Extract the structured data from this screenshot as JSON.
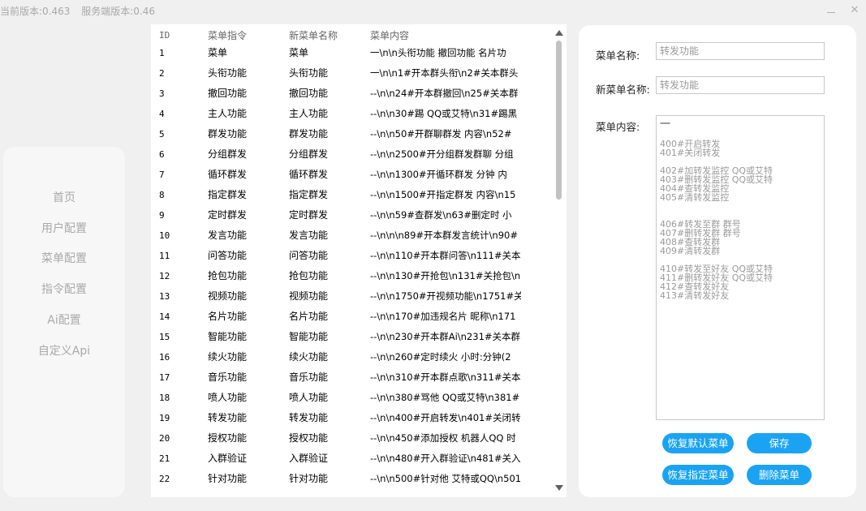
{
  "title_bar": {
    "client_version": "当前版本:0.463",
    "server_version": "服务端版本:0.46",
    "minimize_glyph": "",
    "close_glyph": "✕"
  },
  "sidebar": {
    "items": [
      {
        "label": "首页"
      },
      {
        "label": "用户配置"
      },
      {
        "label": "菜单配置"
      },
      {
        "label": "指令配置"
      },
      {
        "label": "Ai配置"
      },
      {
        "label": "自定义Api"
      }
    ]
  },
  "menu_list": {
    "columns": [
      "ID",
      "菜单指令",
      "新菜单名称",
      "菜单内容"
    ],
    "rows": [
      {
        "id": "1",
        "command": "菜单",
        "name": "菜单",
        "content": "一\\n\\n头衔功能 撤回功能 名片功"
      },
      {
        "id": "2",
        "command": "头衔功能",
        "name": "头衔功能",
        "content": "一\\n\\n1#开本群头衔\\n2#关本群头"
      },
      {
        "id": "3",
        "command": "撤回功能",
        "name": "撤回功能",
        "content": "--\\n\\n24#开本群撤回\\n25#关本群"
      },
      {
        "id": "4",
        "command": "主人功能",
        "name": "主人功能",
        "content": "--\\n\\n30#踢 QQ或艾特\\n31#踢黑"
      },
      {
        "id": "5",
        "command": "群发功能",
        "name": "群发功能",
        "content": "--\\n\\n50#开群聊群发 内容\\n52#"
      },
      {
        "id": "6",
        "command": "分组群发",
        "name": "分组群发",
        "content": "--\\n\\n2500#开分组群发群聊 分组"
      },
      {
        "id": "7",
        "command": "循环群发",
        "name": "循环群发",
        "content": "--\\n\\n1300#开循环群发 分钟 内"
      },
      {
        "id": "8",
        "command": "指定群发",
        "name": "指定群发",
        "content": "--\\n\\n1500#开指定群发 内容\\n15"
      },
      {
        "id": "9",
        "command": "定时群发",
        "name": "定时群发",
        "content": "--\\n\\n59#查群发\\n63#删定时 小"
      },
      {
        "id": "10",
        "command": "发言功能",
        "name": "发言功能",
        "content": "--\\n\\n\\n89#开本群发言统计\\n90#"
      },
      {
        "id": "11",
        "command": "问答功能",
        "name": "问答功能",
        "content": "--\\n\\n110#开本群问答\\n111#关本"
      },
      {
        "id": "12",
        "command": "抢包功能",
        "name": "抢包功能",
        "content": "--\\n\\n130#开抢包\\n131#关抢包\\n"
      },
      {
        "id": "13",
        "command": "视频功能",
        "name": "视频功能",
        "content": "--\\n\\n1750#开视频功能\\n1751#关"
      },
      {
        "id": "14",
        "command": "名片功能",
        "name": "名片功能",
        "content": "--\\n\\n170#加违规名片 昵称\\n171"
      },
      {
        "id": "15",
        "command": "智能功能",
        "name": "智能功能",
        "content": "--\\n\\n230#开本群Ai\\n231#关本群"
      },
      {
        "id": "16",
        "command": "续火功能",
        "name": "续火功能",
        "content": "--\\n\\n260#定时续火 小时:分钟(2"
      },
      {
        "id": "17",
        "command": "音乐功能",
        "name": "音乐功能",
        "content": "--\\n\\n310#开本群点歌\\n311#关本"
      },
      {
        "id": "18",
        "command": "喷人功能",
        "name": "喷人功能",
        "content": "--\\n\\n380#骂他 QQ或艾特\\n381#"
      },
      {
        "id": "19",
        "command": "转发功能",
        "name": "转发功能",
        "content": "--\\n\\n400#开启转发\\n401#关闭转"
      },
      {
        "id": "20",
        "command": "授权功能",
        "name": "授权功能",
        "content": "--\\n\\n450#添加授权 机器人QQ 时"
      },
      {
        "id": "21",
        "command": "入群验证",
        "name": "入群验证",
        "content": "--\\n\\n480#开入群验证\\n481#关入"
      },
      {
        "id": "22",
        "command": "针对功能",
        "name": "针对功能",
        "content": "--\\n\\n500#针对他 艾特或QQ\\n501"
      }
    ]
  },
  "editor": {
    "menu_name_label": "菜单名称:",
    "menu_name_value": "转发功能",
    "new_name_label": "新菜单名称:",
    "new_name_value": "转发功能",
    "content_label": "菜单内容:",
    "content_lines": [
      "一",
      "",
      "400#开启转发",
      "401#关闭转发",
      "",
      "402#加转发监控 QQ或艾特",
      "403#删转发监控 QQ或艾特",
      "404#查转发监控",
      "405#清转发监控",
      "",
      "",
      "406#转发至群 群号",
      "407#删转发群 群号",
      "408#查转发群",
      "409#清转发群",
      "",
      "410#转发至好友 QQ或艾特",
      "411#删转发好友 QQ或艾特",
      "412#查转发好友",
      "413#清转发好友"
    ],
    "restore_default_label": "恢复默认菜单",
    "save_label": "保存",
    "restore_selected_label": "恢复指定菜单",
    "delete_label": "删除菜单"
  },
  "colors": {
    "accent": "#1aa3f3",
    "background": "#f0f0f0",
    "panel": "#ffffff",
    "nav_text": "#a9a9a9"
  }
}
